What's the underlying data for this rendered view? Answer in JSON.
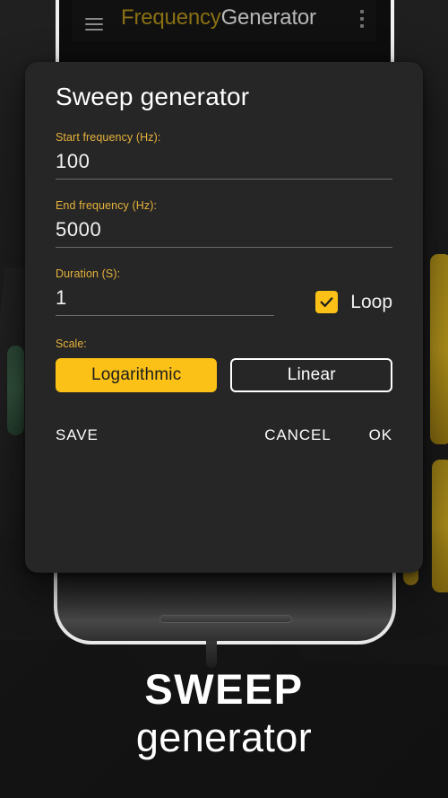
{
  "app_bar": {
    "menu_icon": "hamburger-icon",
    "title_part1": "Frequency",
    "title_part2": "Generator",
    "overflow_icon": "kebab-menu-icon",
    "title_accent_color": "#8a7014"
  },
  "dialog": {
    "title": "Sweep generator",
    "fields": [
      {
        "label": "Start frequency (Hz):",
        "value": "100"
      },
      {
        "label": "End frequency (Hz):",
        "value": "5000"
      },
      {
        "label": "Duration (S):",
        "value": "1"
      }
    ],
    "loop": {
      "label": "Loop",
      "checked": true,
      "check_icon": "checkmark-icon"
    },
    "scale": {
      "label": "Scale:",
      "options": [
        {
          "label": "Logarithmic",
          "selected": true
        },
        {
          "label": "Linear",
          "selected": false
        }
      ]
    },
    "footer": {
      "save": "SAVE",
      "cancel": "CANCEL",
      "ok": "OK"
    },
    "accent_color": "#fbc117",
    "label_color": "#e5b23b",
    "background_color": "#262626"
  },
  "caption": {
    "line1": "SWEEP",
    "line2": "generator"
  }
}
